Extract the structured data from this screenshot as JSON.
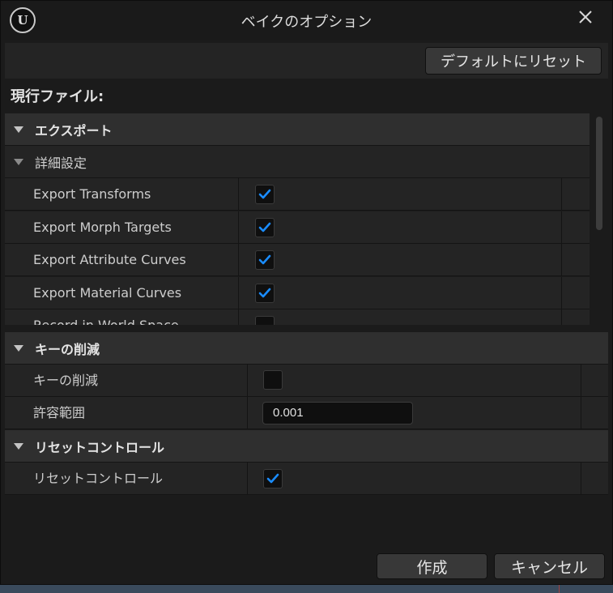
{
  "window": {
    "title": "ベイクのオプション"
  },
  "toolbar": {
    "reset_label": "デフォルトにリセット"
  },
  "current_file_label": "現行ファイル:",
  "export_section": {
    "header": "エクスポート",
    "advanced_header": "詳細設定",
    "rows": [
      {
        "label": "Export Transforms",
        "checked": true
      },
      {
        "label": "Export Morph Targets",
        "checked": true
      },
      {
        "label": "Export Attribute Curves",
        "checked": true
      },
      {
        "label": "Export Material Curves",
        "checked": true
      },
      {
        "label": "Record in World Space",
        "checked": false
      }
    ]
  },
  "key_reduction_section": {
    "header": "キーの削減",
    "reduce_keys": {
      "label": "キーの削減",
      "checked": false
    },
    "tolerance": {
      "label": "許容範囲",
      "value": "0.001"
    }
  },
  "reset_controls_section": {
    "header": "リセットコントロール",
    "reset_controls": {
      "label": "リセットコントロール",
      "checked": true
    }
  },
  "footer": {
    "create_label": "作成",
    "cancel_label": "キャンセル"
  },
  "colors": {
    "accent": "#1a8cff",
    "background": "#1b1b1b",
    "category": "#2f2f2f",
    "row": "#242424"
  },
  "icons": {
    "logo": "unreal-logo-icon",
    "close": "close-icon",
    "check": "checkmark-icon",
    "expand": "triangle-down-icon"
  }
}
